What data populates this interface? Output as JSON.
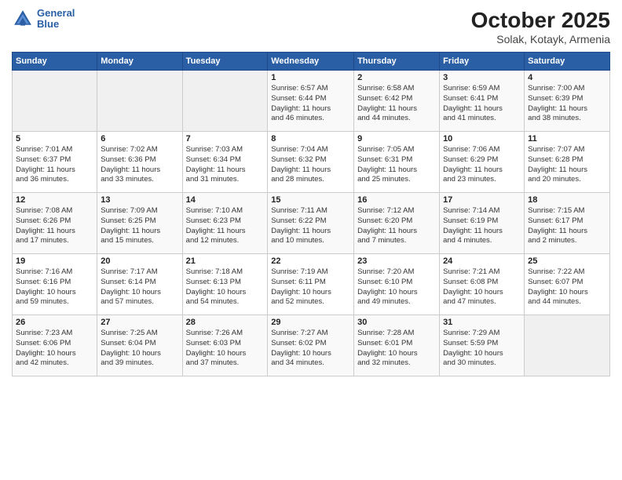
{
  "header": {
    "logo_line1": "General",
    "logo_line2": "Blue",
    "title": "October 2025",
    "subtitle": "Solak, Kotayk, Armenia"
  },
  "weekdays": [
    "Sunday",
    "Monday",
    "Tuesday",
    "Wednesday",
    "Thursday",
    "Friday",
    "Saturday"
  ],
  "weeks": [
    [
      {
        "day": "",
        "content": ""
      },
      {
        "day": "",
        "content": ""
      },
      {
        "day": "",
        "content": ""
      },
      {
        "day": "1",
        "content": "Sunrise: 6:57 AM\nSunset: 6:44 PM\nDaylight: 11 hours\nand 46 minutes."
      },
      {
        "day": "2",
        "content": "Sunrise: 6:58 AM\nSunset: 6:42 PM\nDaylight: 11 hours\nand 44 minutes."
      },
      {
        "day": "3",
        "content": "Sunrise: 6:59 AM\nSunset: 6:41 PM\nDaylight: 11 hours\nand 41 minutes."
      },
      {
        "day": "4",
        "content": "Sunrise: 7:00 AM\nSunset: 6:39 PM\nDaylight: 11 hours\nand 38 minutes."
      }
    ],
    [
      {
        "day": "5",
        "content": "Sunrise: 7:01 AM\nSunset: 6:37 PM\nDaylight: 11 hours\nand 36 minutes."
      },
      {
        "day": "6",
        "content": "Sunrise: 7:02 AM\nSunset: 6:36 PM\nDaylight: 11 hours\nand 33 minutes."
      },
      {
        "day": "7",
        "content": "Sunrise: 7:03 AM\nSunset: 6:34 PM\nDaylight: 11 hours\nand 31 minutes."
      },
      {
        "day": "8",
        "content": "Sunrise: 7:04 AM\nSunset: 6:32 PM\nDaylight: 11 hours\nand 28 minutes."
      },
      {
        "day": "9",
        "content": "Sunrise: 7:05 AM\nSunset: 6:31 PM\nDaylight: 11 hours\nand 25 minutes."
      },
      {
        "day": "10",
        "content": "Sunrise: 7:06 AM\nSunset: 6:29 PM\nDaylight: 11 hours\nand 23 minutes."
      },
      {
        "day": "11",
        "content": "Sunrise: 7:07 AM\nSunset: 6:28 PM\nDaylight: 11 hours\nand 20 minutes."
      }
    ],
    [
      {
        "day": "12",
        "content": "Sunrise: 7:08 AM\nSunset: 6:26 PM\nDaylight: 11 hours\nand 17 minutes."
      },
      {
        "day": "13",
        "content": "Sunrise: 7:09 AM\nSunset: 6:25 PM\nDaylight: 11 hours\nand 15 minutes."
      },
      {
        "day": "14",
        "content": "Sunrise: 7:10 AM\nSunset: 6:23 PM\nDaylight: 11 hours\nand 12 minutes."
      },
      {
        "day": "15",
        "content": "Sunrise: 7:11 AM\nSunset: 6:22 PM\nDaylight: 11 hours\nand 10 minutes."
      },
      {
        "day": "16",
        "content": "Sunrise: 7:12 AM\nSunset: 6:20 PM\nDaylight: 11 hours\nand 7 minutes."
      },
      {
        "day": "17",
        "content": "Sunrise: 7:14 AM\nSunset: 6:19 PM\nDaylight: 11 hours\nand 4 minutes."
      },
      {
        "day": "18",
        "content": "Sunrise: 7:15 AM\nSunset: 6:17 PM\nDaylight: 11 hours\nand 2 minutes."
      }
    ],
    [
      {
        "day": "19",
        "content": "Sunrise: 7:16 AM\nSunset: 6:16 PM\nDaylight: 10 hours\nand 59 minutes."
      },
      {
        "day": "20",
        "content": "Sunrise: 7:17 AM\nSunset: 6:14 PM\nDaylight: 10 hours\nand 57 minutes."
      },
      {
        "day": "21",
        "content": "Sunrise: 7:18 AM\nSunset: 6:13 PM\nDaylight: 10 hours\nand 54 minutes."
      },
      {
        "day": "22",
        "content": "Sunrise: 7:19 AM\nSunset: 6:11 PM\nDaylight: 10 hours\nand 52 minutes."
      },
      {
        "day": "23",
        "content": "Sunrise: 7:20 AM\nSunset: 6:10 PM\nDaylight: 10 hours\nand 49 minutes."
      },
      {
        "day": "24",
        "content": "Sunrise: 7:21 AM\nSunset: 6:08 PM\nDaylight: 10 hours\nand 47 minutes."
      },
      {
        "day": "25",
        "content": "Sunrise: 7:22 AM\nSunset: 6:07 PM\nDaylight: 10 hours\nand 44 minutes."
      }
    ],
    [
      {
        "day": "26",
        "content": "Sunrise: 7:23 AM\nSunset: 6:06 PM\nDaylight: 10 hours\nand 42 minutes."
      },
      {
        "day": "27",
        "content": "Sunrise: 7:25 AM\nSunset: 6:04 PM\nDaylight: 10 hours\nand 39 minutes."
      },
      {
        "day": "28",
        "content": "Sunrise: 7:26 AM\nSunset: 6:03 PM\nDaylight: 10 hours\nand 37 minutes."
      },
      {
        "day": "29",
        "content": "Sunrise: 7:27 AM\nSunset: 6:02 PM\nDaylight: 10 hours\nand 34 minutes."
      },
      {
        "day": "30",
        "content": "Sunrise: 7:28 AM\nSunset: 6:01 PM\nDaylight: 10 hours\nand 32 minutes."
      },
      {
        "day": "31",
        "content": "Sunrise: 7:29 AM\nSunset: 5:59 PM\nDaylight: 10 hours\nand 30 minutes."
      },
      {
        "day": "",
        "content": ""
      }
    ]
  ]
}
